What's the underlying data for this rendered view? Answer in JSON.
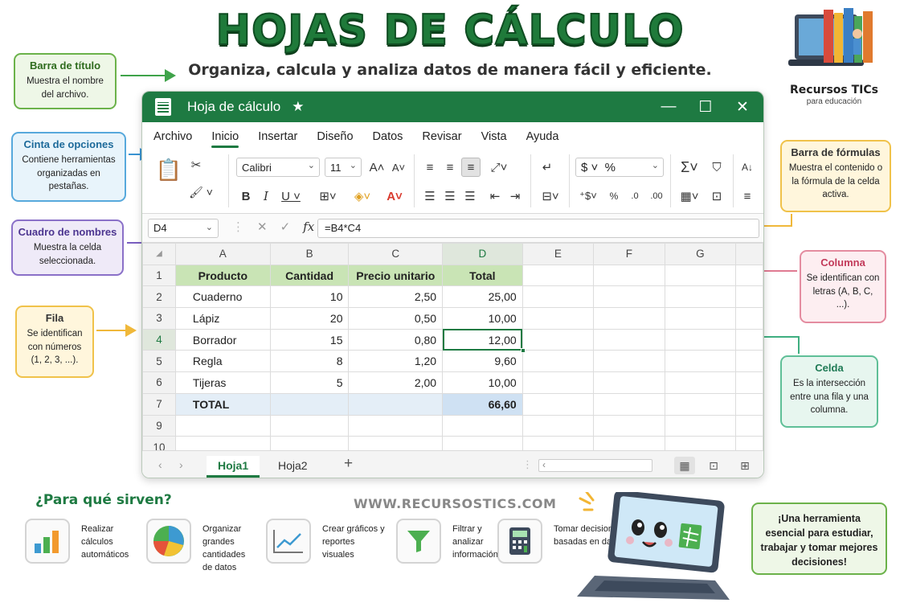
{
  "header": {
    "title": "HOJAS DE CÁLCULO",
    "subtitle": "Organiza, calcula y analiza datos de manera fácil y eficiente."
  },
  "logo": {
    "name": "Recursos TICs",
    "tagline": "para educación"
  },
  "callouts": {
    "title_bar": {
      "title": "Barra de título",
      "desc": "Muestra el nombre del archivo."
    },
    "ribbon": {
      "title": "Cinta de opciones",
      "desc": "Contiene herramientas organizadas en pestañas."
    },
    "name_box": {
      "title": "Cuadro de nombres",
      "desc": "Muestra la celda seleccionada."
    },
    "row": {
      "title": "Fila",
      "desc": "Se identifican con números (1, 2, 3, ...)."
    },
    "formula_bar": {
      "title": "Barra de fórmulas",
      "desc": "Muestra el contenido o la fórmula de la celda activa."
    },
    "column": {
      "title": "Columna",
      "desc": "Se identifican con letras (A, B, C, ...)."
    },
    "cell": {
      "title": "Celda",
      "desc": "Es la intersección entre una fila y una columna."
    }
  },
  "window": {
    "title": "Hoja de cálculo",
    "menu": [
      "Archivo",
      "Inicio",
      "Insertar",
      "Diseño",
      "Datos",
      "Revisar",
      "Vista",
      "Ayuda"
    ],
    "active_menu": "Inicio",
    "ribbon": {
      "font": "Calibri",
      "font_size": "11"
    },
    "name_box": "D4",
    "formula": "=B4*C4",
    "columns": [
      "A",
      "B",
      "C",
      "D",
      "E",
      "F",
      "G"
    ],
    "selected_column": "D",
    "selected_row": "4",
    "header_row": [
      "Producto",
      "Cantidad",
      "Precio unitario",
      "Total"
    ],
    "rows": [
      {
        "n": "2",
        "product": "Cuaderno",
        "qty": "10",
        "price": "2,50",
        "total": "25,00"
      },
      {
        "n": "3",
        "product": "Lápiz",
        "qty": "20",
        "price": "0,50",
        "total": "10,00"
      },
      {
        "n": "4",
        "product": "Borrador",
        "qty": "15",
        "price": "0,80",
        "total": "12,00"
      },
      {
        "n": "5",
        "product": "Regla",
        "qty": "8",
        "price": "1,20",
        "total": "9,60"
      },
      {
        "n": "6",
        "product": "Tijeras",
        "qty": "5",
        "price": "2,00",
        "total": "10,00"
      }
    ],
    "total_row": {
      "n": "7",
      "label": "TOTAL",
      "value": "66,60"
    },
    "empty_rows": [
      "9",
      "10"
    ],
    "sheets": [
      "Hoja1",
      "Hoja2"
    ],
    "active_sheet": "Hoja1"
  },
  "uses": {
    "title": "¿Para qué sirven?",
    "items": [
      {
        "icon": "bar-chart-icon",
        "text": "Realizar cálculos automáticos"
      },
      {
        "icon": "pie-chart-icon",
        "text": "Organizar grandes cantidades de datos"
      },
      {
        "icon": "line-chart-icon",
        "text": "Crear gráficos y reportes visuales"
      },
      {
        "icon": "filter-icon",
        "text": "Filtrar y analizar información"
      },
      {
        "icon": "calculator-icon",
        "text": "Tomar decisiones basadas en datos"
      }
    ]
  },
  "website": "WWW.RECURSOSTICS.COM",
  "closing": "¡Una herramienta esencial para estudiar, trabajar y tomar mejores decisiones!",
  "colors": {
    "brand_green": "#1e7a42",
    "header_fill": "#c9e4b5",
    "total_fill": "#cfe1f3"
  }
}
